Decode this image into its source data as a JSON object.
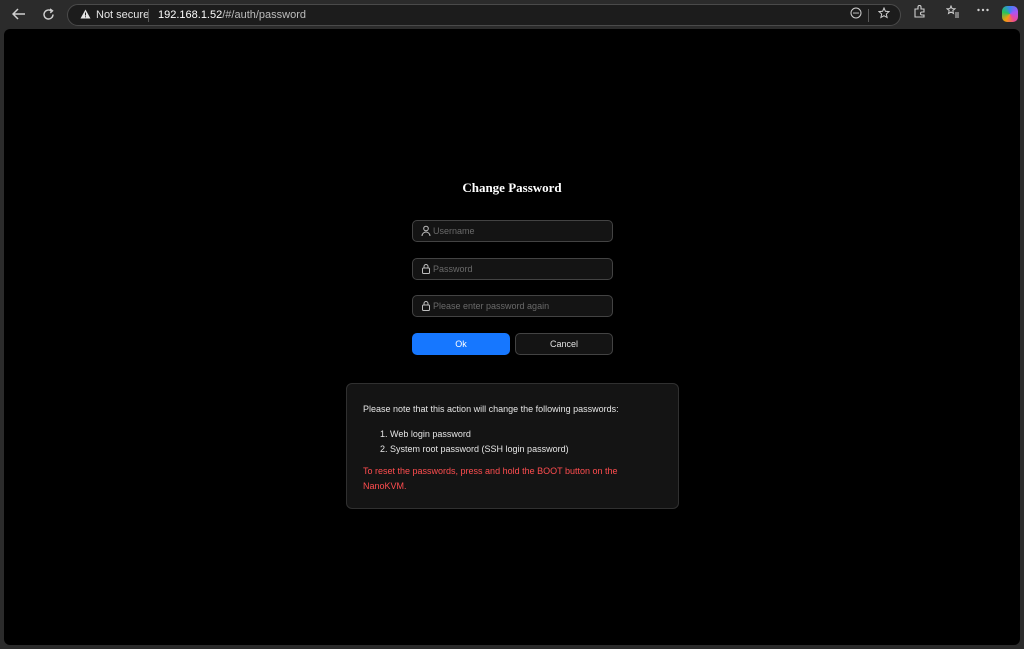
{
  "browser": {
    "security_label": "Not secure",
    "url_host": "192.168.1.52",
    "url_path": "/#/auth/password"
  },
  "page": {
    "title": "Change Password",
    "username_placeholder": "Username",
    "password_placeholder": "Password",
    "confirm_placeholder": "Please enter password again",
    "ok_label": "Ok",
    "cancel_label": "Cancel"
  },
  "notice": {
    "intro": "Please note that this action will change the following passwords:",
    "items": [
      "1. Web login password",
      "2. System root password (SSH login password)"
    ],
    "warning": "To reset the passwords, press and hold the BOOT button on the NanoKVM."
  },
  "colors": {
    "accent": "#1677ff",
    "warning": "#ff4d4f"
  }
}
